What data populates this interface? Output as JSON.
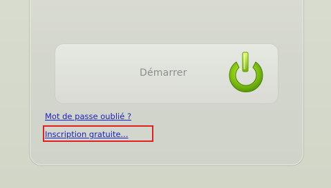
{
  "login": {
    "start_button_label": "Démarrer",
    "forgot_password_link": "Mot de passe oublié ?",
    "signup_link": "Inscription gratuite..."
  },
  "icons": {
    "start_icon": "power-icon"
  },
  "colors": {
    "page_background": "#d3d8ca",
    "panel_background": "#d6d9d0",
    "button_background": "#e2e4de",
    "link_color": "#1a21c9",
    "highlight_border": "#df1f1f",
    "icon_green": "#8ecb12"
  }
}
